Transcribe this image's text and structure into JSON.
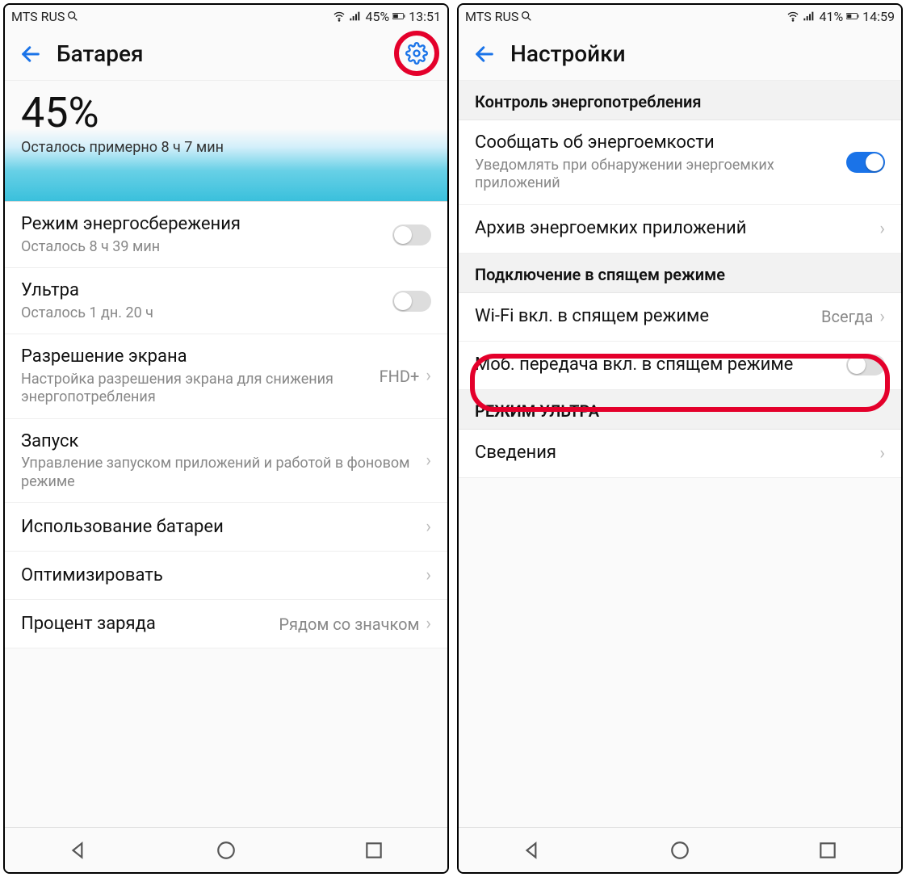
{
  "phone1": {
    "status": {
      "carrier": "MTS RUS",
      "battery_pct": "45%",
      "time": "13:51"
    },
    "header": {
      "title": "Батарея"
    },
    "hero": {
      "pct": "45%",
      "remaining": "Осталось примерно 8 ч 7 мин"
    },
    "rows": {
      "powersave": {
        "title": "Режим энергосбережения",
        "sub": "Осталось 8 ч 39 мин"
      },
      "ultra": {
        "title": "Ультра",
        "sub": "Осталось 1 дн. 20 ч"
      },
      "resolution": {
        "title": "Разрешение экрана",
        "sub": "Настройка разрешения экрана для снижения энергопотребления",
        "value": "FHD+"
      },
      "launch": {
        "title": "Запуск",
        "sub": "Управление запуском приложений и работой в фоновом режиме"
      },
      "usage": {
        "title": "Использование батареи"
      },
      "optimize": {
        "title": "Оптимизировать"
      },
      "pct_mode": {
        "title": "Процент заряда",
        "value": "Рядом со значком"
      }
    }
  },
  "phone2": {
    "status": {
      "carrier": "MTS RUS",
      "battery_pct": "41%",
      "time": "14:59"
    },
    "header": {
      "title": "Настройки"
    },
    "sections": {
      "s1": "Контроль энергопотребления",
      "s2": "Подключение в спящем режиме",
      "s3": "РЕЖИМ УЛЬТРА"
    },
    "rows": {
      "notify": {
        "title": "Сообщать об энергоемкости",
        "sub": "Уведомлять при обнаружении энергоемких приложений"
      },
      "archive": {
        "title": "Архив энергоемких приложений"
      },
      "wifi_sleep": {
        "title": "Wi-Fi вкл. в спящем режиме",
        "value": "Всегда"
      },
      "mobile_sleep": {
        "title": "Моб. передача вкл. в спящем режиме"
      },
      "about": {
        "title": "Сведения"
      }
    }
  }
}
